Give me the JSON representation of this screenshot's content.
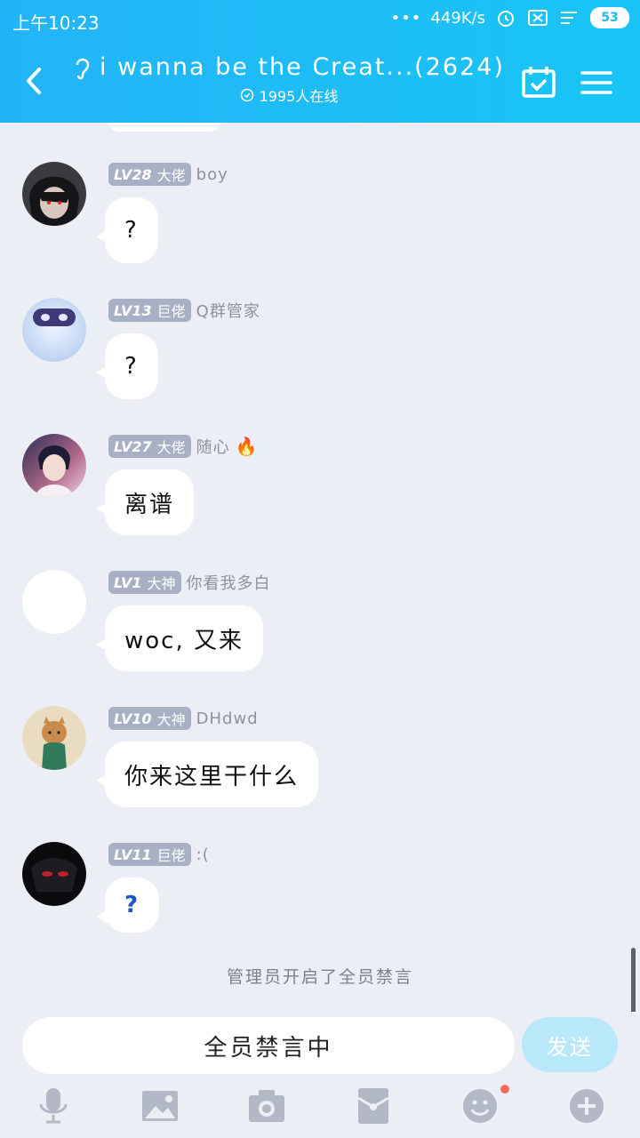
{
  "status_bar": {
    "time": "上午10:23",
    "network_speed": "449K/s",
    "battery": "53"
  },
  "header": {
    "title": "i wanna be the Creat...(2624)",
    "online": "1995人在线"
  },
  "messages": [
    {
      "lv": "LV28",
      "rank": "大佬",
      "nick": "boy",
      "text": "?"
    },
    {
      "lv": "LV13",
      "rank": "巨佬",
      "nick": "Q群管家",
      "text": "?"
    },
    {
      "lv": "LV27",
      "rank": "大佬",
      "nick": "随心",
      "nick_emoji": "🔥",
      "text": "离谱"
    },
    {
      "lv": "LV1",
      "rank": "大神",
      "nick": "你看我多白",
      "text": "woc, 又来"
    },
    {
      "lv": "LV10",
      "rank": "大神",
      "nick": "DHdwd",
      "text": "你来这里干什么"
    },
    {
      "lv": "LV11",
      "rank": "巨佬",
      "nick": ":(",
      "text": "?"
    }
  ],
  "system_note": "管理员开启了全员禁言",
  "input": {
    "placeholder": "全员禁言中",
    "send_label": "发送"
  },
  "toolbar_icons": [
    "microphone-icon",
    "image-icon",
    "camera-icon",
    "red-packet-icon",
    "emoji-icon",
    "plus-icon"
  ]
}
